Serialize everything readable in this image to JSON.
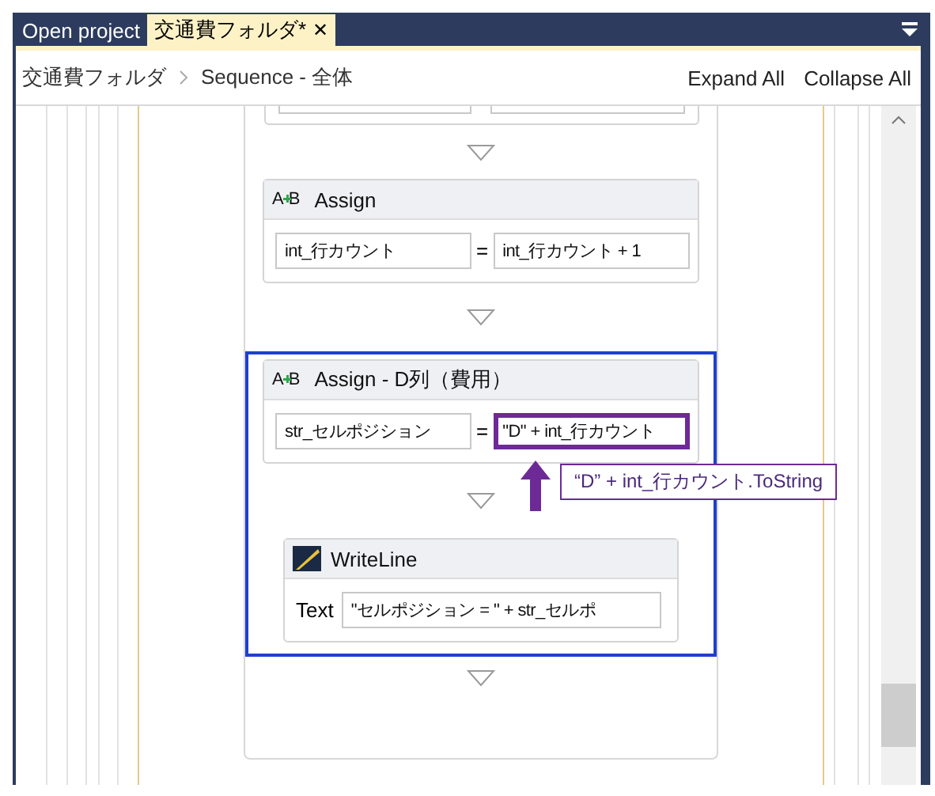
{
  "tabs": [
    {
      "label": "Open project",
      "selected": false
    },
    {
      "label": "交通費フォルダ*",
      "selected": true,
      "close": "✕"
    }
  ],
  "breadcrumb": [
    "交通費フォルダ",
    "Sequence - 全体"
  ],
  "toolbar_links": [
    "Expand All",
    "Collapse All"
  ],
  "sequence": [
    {
      "kind": "assign",
      "clipped": true
    },
    {
      "kind": "assign",
      "icon": "AB",
      "title": "Assign",
      "to": {
        "value": "int_行カウント"
      },
      "eq": "=",
      "expr": {
        "value": "int_行カウント + 1",
        "highlighted": false
      }
    },
    {
      "kind": "group",
      "selected": true,
      "children": [
        {
          "kind": "assign",
          "icon": "AB",
          "title": "Assign - D列（費用）",
          "to": {
            "value": "str_セルポジション"
          },
          "eq": "=",
          "expr": {
            "value": "\"D\" + int_行カウント",
            "highlighted": true,
            "callout": "“D” + int_行カウント.ToString"
          }
        },
        {
          "kind": "writeline",
          "title": "WriteLine",
          "label": "Text",
          "field": {
            "value": "\"セルポジション = \" + str_セルポ"
          }
        }
      ]
    }
  ]
}
